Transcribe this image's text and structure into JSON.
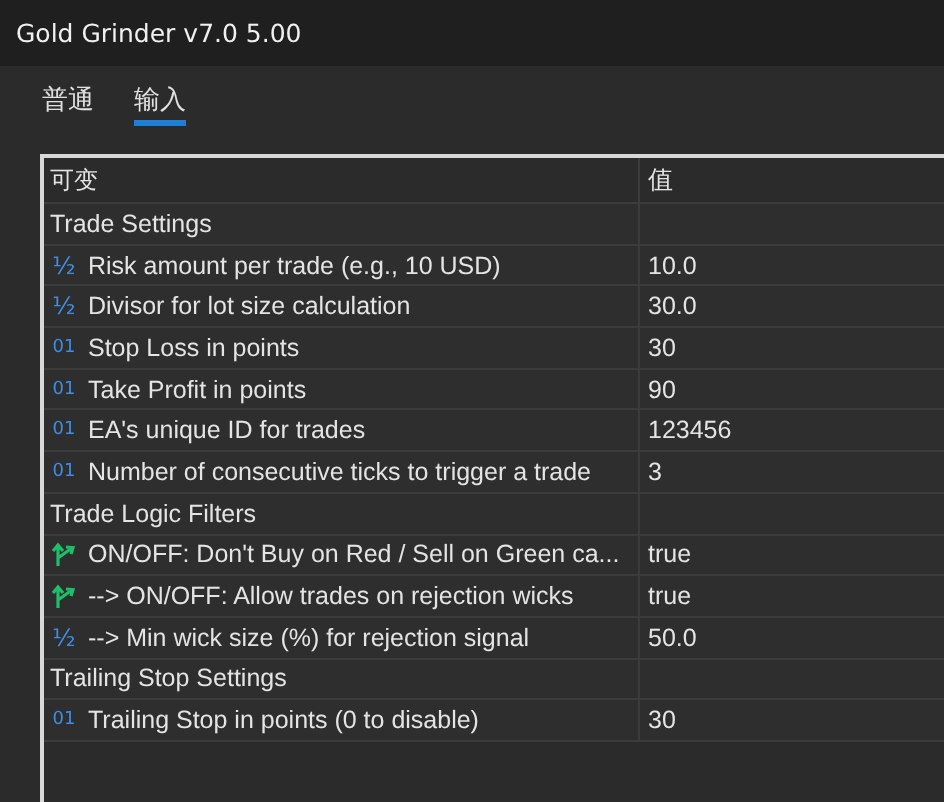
{
  "window": {
    "title": "Gold Grinder v7.0 5.00"
  },
  "tabs": [
    {
      "label": "普通",
      "selected": false
    },
    {
      "label": "输入",
      "selected": true
    }
  ],
  "table": {
    "columns": [
      "可变",
      "值"
    ],
    "rows": [
      {
        "kind": "group",
        "name": "Trade Settings"
      },
      {
        "kind": "double",
        "type_glyph": "½",
        "name": "Risk amount per trade (e.g., 10 USD)",
        "value": "10.0"
      },
      {
        "kind": "double",
        "type_glyph": "½",
        "name": "Divisor for lot size calculation",
        "value": "30.0"
      },
      {
        "kind": "int",
        "type_glyph": "01",
        "name": "Stop Loss in points",
        "value": "30"
      },
      {
        "kind": "int",
        "type_glyph": "01",
        "name": "Take Profit in points",
        "value": "90"
      },
      {
        "kind": "int",
        "type_glyph": "01",
        "name": "EA's unique ID for trades",
        "value": "123456"
      },
      {
        "kind": "int",
        "type_glyph": "01",
        "name": "Number of consecutive ticks to trigger a trade",
        "value": "3"
      },
      {
        "kind": "group",
        "name": "Trade Logic Filters"
      },
      {
        "kind": "bool",
        "name": "ON/OFF: Don't Buy on Red / Sell on Green ca...",
        "value": "true"
      },
      {
        "kind": "bool",
        "name": "--> ON/OFF: Allow trades on rejection wicks",
        "value": "true"
      },
      {
        "kind": "double",
        "type_glyph": "½",
        "name": "--> Min wick size (%) for rejection signal",
        "value": "50.0"
      },
      {
        "kind": "group",
        "name": "Trailing Stop Settings"
      },
      {
        "kind": "int",
        "type_glyph": "01",
        "name": "Trailing Stop in points (0 to disable)",
        "value": "30"
      }
    ]
  }
}
